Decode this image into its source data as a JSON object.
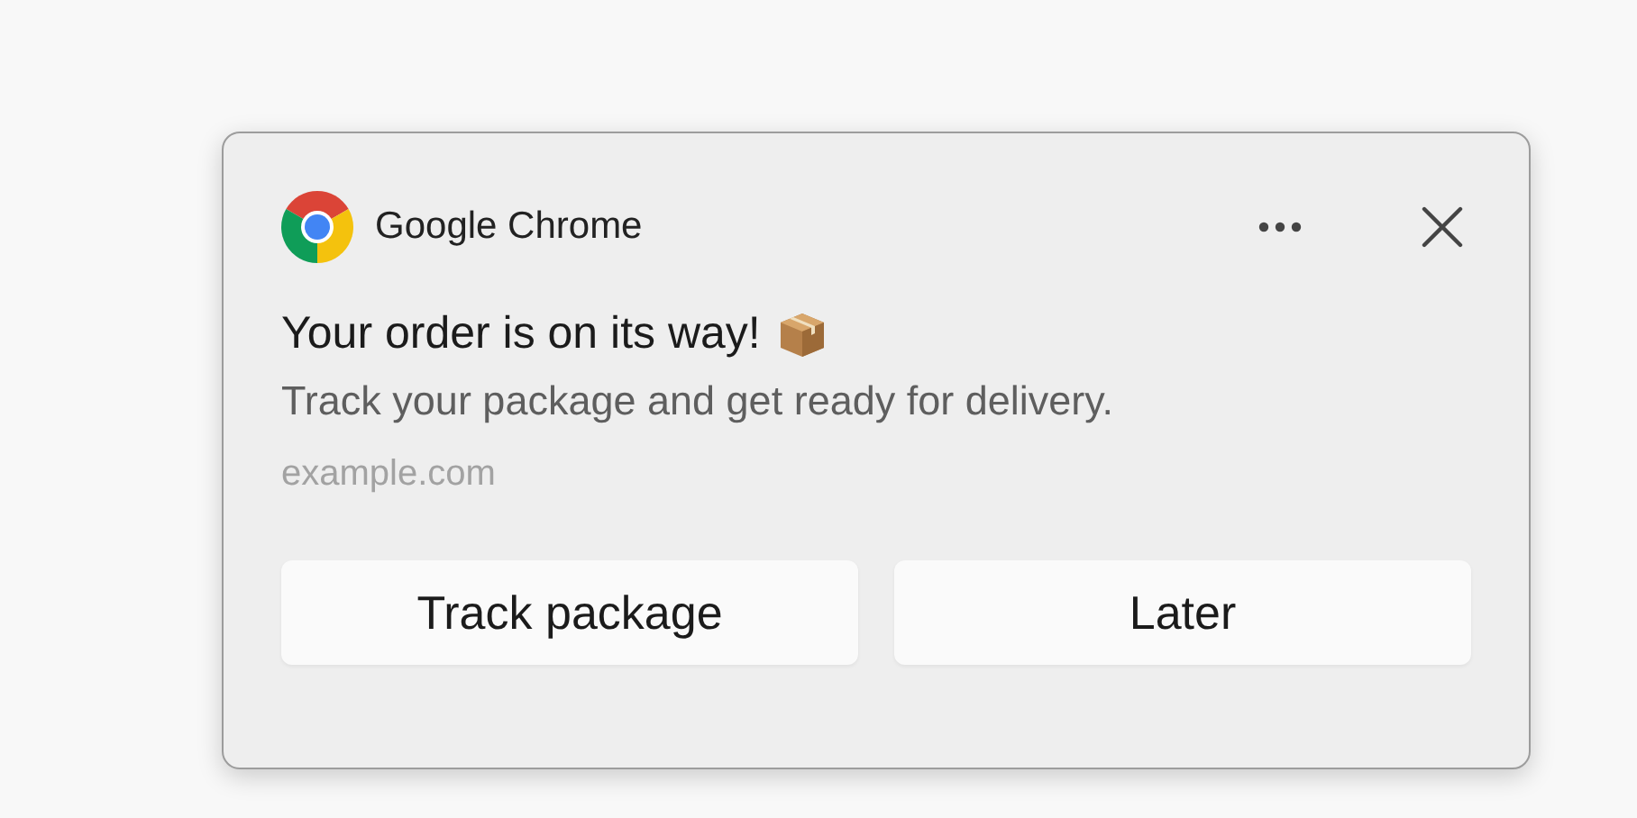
{
  "notification": {
    "app_name": "Google Chrome",
    "title": "Your order is on its way!",
    "body": "Track your package and get ready for delivery.",
    "source": "example.com",
    "actions": [
      {
        "label": "Track package"
      },
      {
        "label": "Later"
      }
    ]
  }
}
